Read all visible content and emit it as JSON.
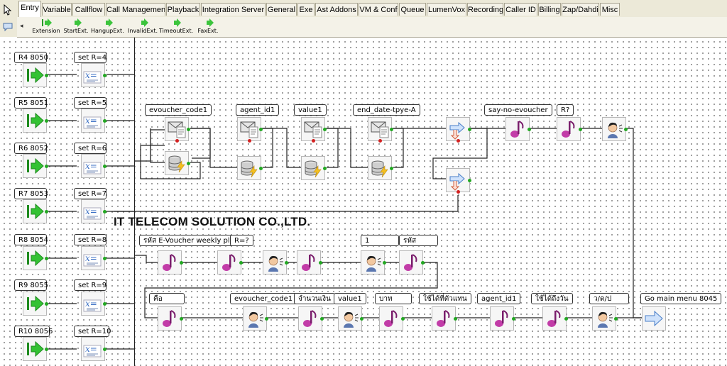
{
  "tabs": [
    "Entry",
    "Variable",
    "Callflow",
    "Call Management",
    "Playback",
    "Integration Server",
    "General",
    "Exe",
    "Ast Addons",
    "VM & Conf",
    "Queue",
    "LumenVox",
    "Recording",
    "Caller ID",
    "Billing",
    "Zap/Dahdi",
    "Misc"
  ],
  "toolbar": {
    "items": [
      {
        "label": "Extension",
        "key": ""
      },
      {
        "label": "StartExt.",
        "key": "s"
      },
      {
        "label": "HangupExt.",
        "key": "h"
      },
      {
        "label": "InvalidExt.",
        "key": "i"
      },
      {
        "label": "TimeoutExt.",
        "key": "t"
      },
      {
        "label": "FaxExt.",
        "key": "f"
      }
    ]
  },
  "canvas": {
    "watermark": "IT TELECOM SOLUTION CO.,LTD.",
    "extension_rows": [
      {
        "ext_label": "R4 8050",
        "set_label": "set R=4"
      },
      {
        "ext_label": "R5 8051",
        "set_label": "set R=5"
      },
      {
        "ext_label": "R6 8052",
        "set_label": "set R=6"
      },
      {
        "ext_label": "R7 8053",
        "set_label": "set R=7"
      },
      {
        "ext_label": "R8 8054",
        "set_label": "set R=8"
      },
      {
        "ext_label": "R9 8055",
        "set_label": "set R=9"
      },
      {
        "ext_label": "R10 8056",
        "set_label": "set R=10"
      }
    ],
    "labels": {
      "evoucher_code1_a": "evoucher_code1",
      "agent_id1_a": "agent_id1",
      "value1_a": "value1",
      "end_date": "end_date-tpye-A",
      "say_no": "say-no-evoucher",
      "r_q": "R?",
      "rahat": "รหัส E-Voucher weekly pls",
      "r_eq": "R=?",
      "one": "1",
      "rahat2": "รหัส",
      "khue": "คือ",
      "evoucher_code1_b": "evoucher_code1",
      "jamnuan": "จำนวนเงิน",
      "value1_b": "value1",
      "baht": "บาท",
      "chai_tua": "ใช้ได้ที่ตัวแทน",
      "agent_id1_b": "agent_id1",
      "chai_thueng": "ใช้ได้ถึงวัน",
      "date_fmt": "ว/ด/ป",
      "goto_main": "Go main menu 8045"
    }
  }
}
